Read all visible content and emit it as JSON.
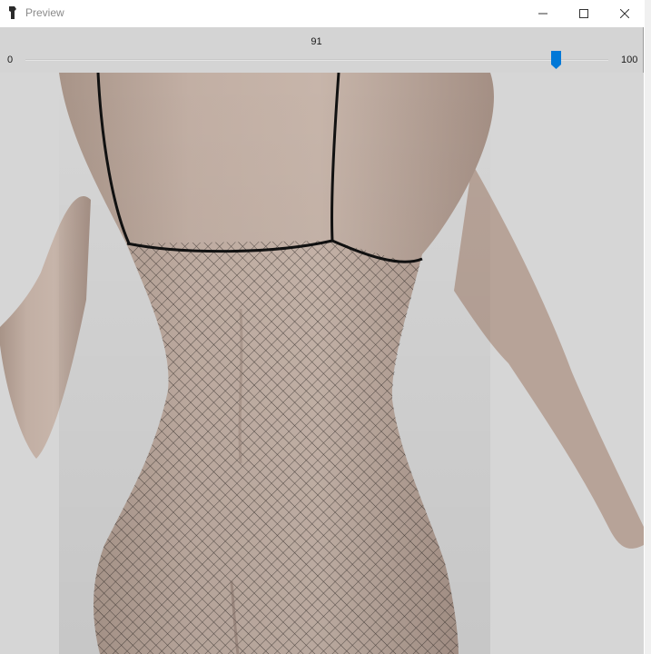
{
  "window": {
    "title": "Preview",
    "controls": [
      "minimize",
      "maximize",
      "close"
    ]
  },
  "slider": {
    "value": "91",
    "min_label": "0",
    "max_label": "100",
    "min": 0,
    "max": 100,
    "current": 91,
    "accent_color": "#0078d7"
  },
  "preview": {
    "content": "3D render of a figure seen from the back wearing a fishnet slip dress",
    "background_color": "#d6d6d6",
    "skin_color": "#bfaa9e"
  },
  "icons": {
    "app": "app-icon",
    "minimize": "minimize-icon",
    "maximize": "maximize-icon",
    "close": "close-icon"
  }
}
